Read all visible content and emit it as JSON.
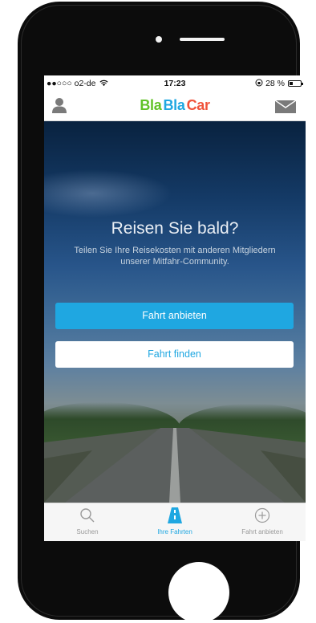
{
  "status_bar": {
    "carrier": "●●○○○ o2-de",
    "time": "17:23",
    "battery": "28 %",
    "battery_level": 0.28
  },
  "navbar": {
    "logo_parts": [
      "Bla",
      "Bla",
      "Car"
    ],
    "logo_colors": [
      "#61c227",
      "#1fa7e1",
      "#f0533b"
    ]
  },
  "hero": {
    "title": "Reisen Sie bald?",
    "subtitle": "Teilen Sie Ihre Reisekosten mit anderen Mitgliedern unserer Mitfahr-Community.",
    "primary_button": "Fahrt anbieten",
    "secondary_button": "Fahrt finden"
  },
  "tabbar": {
    "tabs": [
      {
        "label": "Suchen",
        "icon": "search-icon",
        "active": false
      },
      {
        "label": "Ihre Fahrten",
        "icon": "road-icon",
        "active": true
      },
      {
        "label": "Fahrt anbieten",
        "icon": "plus-circle-icon",
        "active": false
      }
    ]
  },
  "colors": {
    "accent": "#1fa7e1",
    "inactive": "#9a9a9a"
  }
}
